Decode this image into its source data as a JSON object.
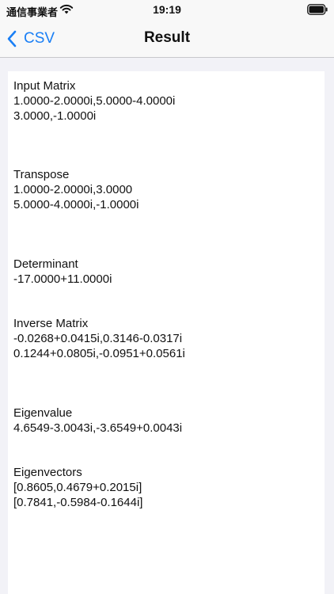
{
  "status": {
    "carrier": "通信事業者",
    "time": "19:19"
  },
  "nav": {
    "back_label": "CSV",
    "title": "Result"
  },
  "sections": [
    {
      "heading": "Input Matrix",
      "lines": [
        "1.0000-2.0000i,5.0000-4.0000i",
        "3.0000,-1.0000i"
      ]
    },
    {
      "heading": "Transpose",
      "lines": [
        "1.0000-2.0000i,3.0000",
        "5.0000-4.0000i,-1.0000i"
      ]
    },
    {
      "heading": "Determinant",
      "lines": [
        "-17.0000+11.0000i"
      ]
    },
    {
      "heading": "Inverse Matrix",
      "lines": [
        "-0.0268+0.0415i,0.3146-0.0317i",
        "0.1244+0.0805i,-0.0951+0.0561i"
      ]
    },
    {
      "heading": "Eigenvalue",
      "lines": [
        "4.6549-3.0043i,-3.6549+0.0043i"
      ]
    },
    {
      "heading": "Eigenvectors",
      "lines": [
        "[0.8605,0.4679+0.2015i]",
        "[0.7841,-0.5984-0.1644i]"
      ]
    }
  ],
  "colors": {
    "accent": "#1a7ff5",
    "background": "#f2f2f7",
    "panel": "#ffffff"
  }
}
